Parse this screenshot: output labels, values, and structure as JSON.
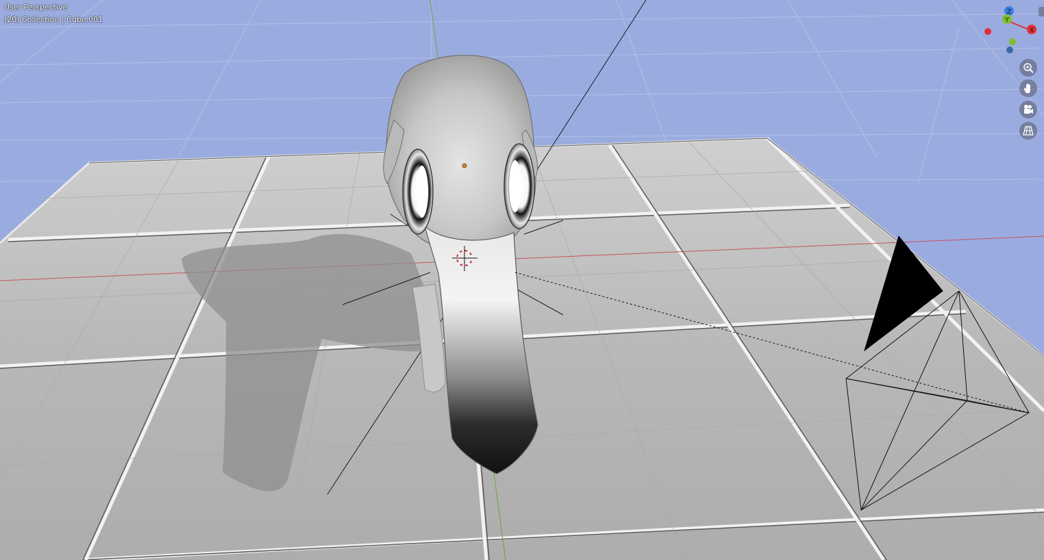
{
  "viewport": {
    "view_name": "User Perspective",
    "collection_info": "(20) Collection | Cube.001"
  },
  "navigation_gizmo": {
    "axes": [
      {
        "label": "Z",
        "color": "#3b7ee0"
      },
      {
        "label": "Y",
        "color": "#7cc02a"
      },
      {
        "label": "X",
        "color": "#e0303a"
      }
    ]
  },
  "nav_buttons": [
    {
      "icon": "zoom-icon"
    },
    {
      "icon": "pan-hand-icon"
    },
    {
      "icon": "camera-view-icon"
    },
    {
      "icon": "ortho-grid-icon"
    }
  ],
  "colors": {
    "sky": "#9aacdf",
    "floor": "#b9b9b9",
    "tile_gap": "#f4f4f4",
    "x_axis_line": "#c6525a",
    "y_axis_line": "#6aa24a",
    "origin_dot": "#d9862b"
  }
}
